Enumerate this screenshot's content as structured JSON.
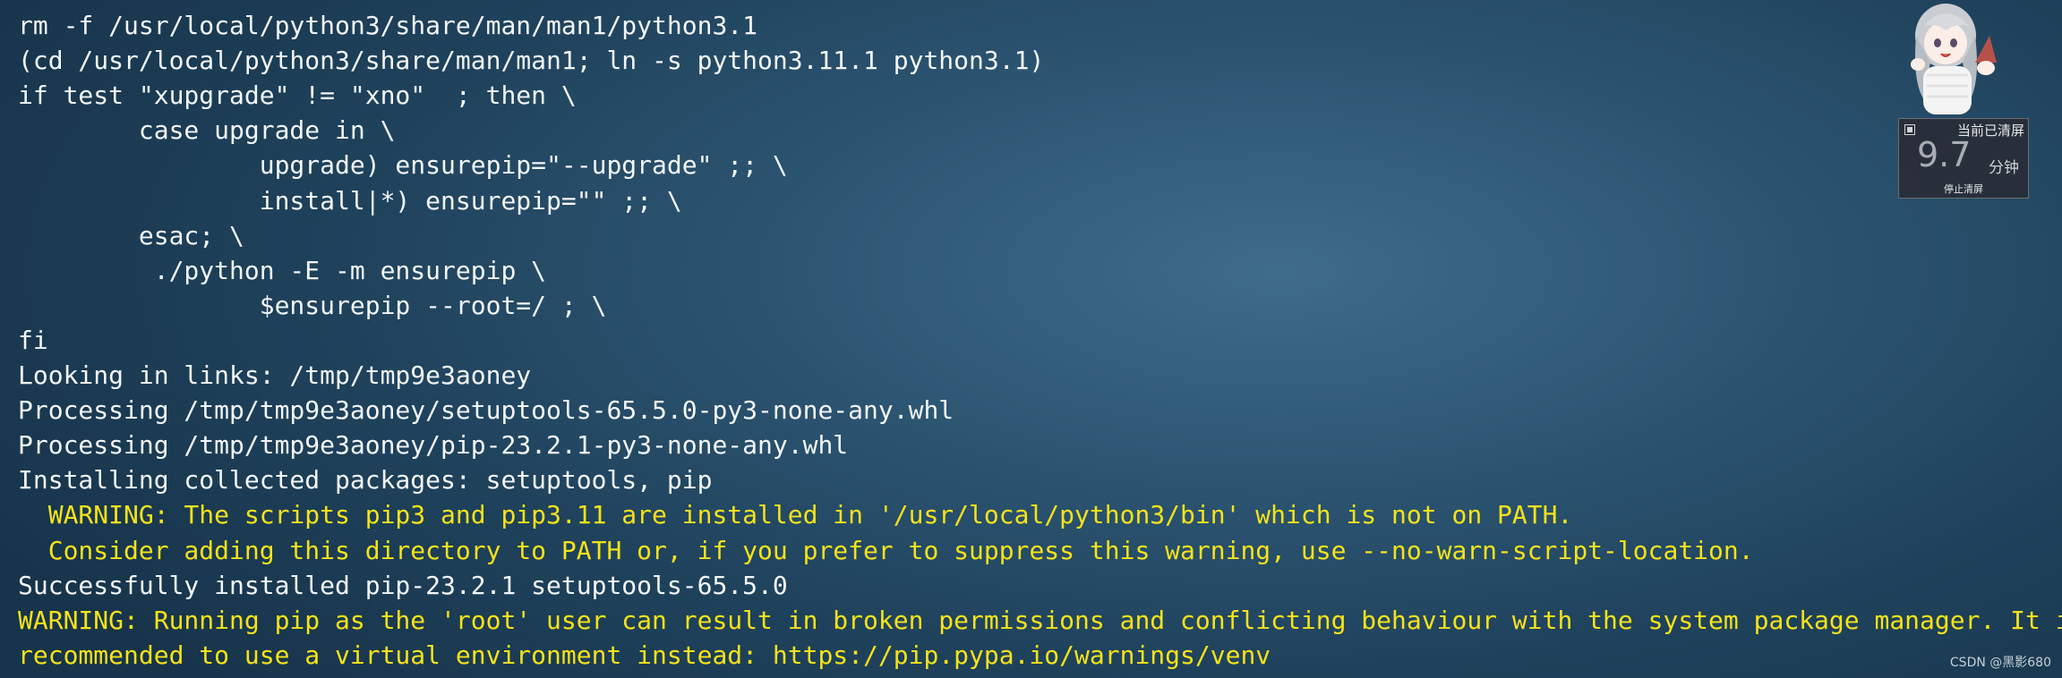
{
  "terminal": {
    "lines": [
      {
        "text": "rm -f /usr/local/python3/share/man/man1/python3.1",
        "style": "normal"
      },
      {
        "text": "(cd /usr/local/python3/share/man/man1; ln -s python3.11.1 python3.1)",
        "style": "normal"
      },
      {
        "text": "if test \"xupgrade\" != \"xno\"  ; then \\",
        "style": "normal"
      },
      {
        "text": "        case upgrade in \\",
        "style": "normal"
      },
      {
        "text": "                upgrade) ensurepip=\"--upgrade\" ;; \\",
        "style": "normal"
      },
      {
        "text": "                install|*) ensurepip=\"\" ;; \\",
        "style": "normal"
      },
      {
        "text": "        esac; \\",
        "style": "normal"
      },
      {
        "text": "         ./python -E -m ensurepip \\",
        "style": "normal"
      },
      {
        "text": "                $ensurepip --root=/ ; \\",
        "style": "normal"
      },
      {
        "text": "fi",
        "style": "normal"
      },
      {
        "text": "Looking in links: /tmp/tmp9e3aoney",
        "style": "normal"
      },
      {
        "text": "Processing /tmp/tmp9e3aoney/setuptools-65.5.0-py3-none-any.whl",
        "style": "normal"
      },
      {
        "text": "Processing /tmp/tmp9e3aoney/pip-23.2.1-py3-none-any.whl",
        "style": "normal"
      },
      {
        "text": "Installing collected packages: setuptools, pip",
        "style": "normal"
      },
      {
        "text": "  WARNING: The scripts pip3 and pip3.11 are installed in '/usr/local/python3/bin' which is not on PATH.",
        "style": "warn"
      },
      {
        "text": "  Consider adding this directory to PATH or, if you prefer to suppress this warning, use --no-warn-script-location.",
        "style": "warn"
      },
      {
        "text": "Successfully installed pip-23.2.1 setuptools-65.5.0",
        "style": "normal"
      },
      {
        "text": "WARNING: Running pip as the 'root' user can result in broken permissions and conflicting behaviour with the system package manager. It is",
        "style": "warn"
      },
      {
        "text": "recommended to use a virtual environment instead: https://pip.pypa.io/warnings/venv",
        "style": "warn"
      }
    ]
  },
  "overlay": {
    "status": "当前已清屏",
    "value": "9.7",
    "unit": "分钟",
    "stop_label": "停止清屏"
  },
  "watermark": "CSDN @黑影680",
  "colors": {
    "text": "#f3f5f7",
    "warning": "#f5e21a",
    "background": "#2c5572"
  }
}
